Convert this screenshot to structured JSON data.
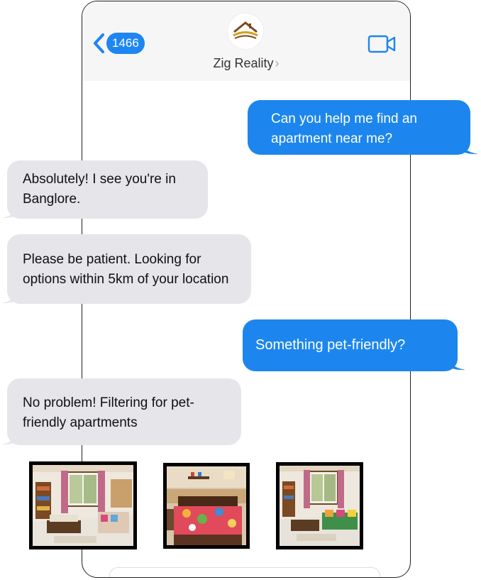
{
  "header": {
    "back_count": "1466",
    "contact_name": "Zig Reality",
    "contact_chevron": "›",
    "back_icon": "chevron-left-icon",
    "video_icon": "video-camera-icon",
    "logo": "house-logo"
  },
  "messages": [
    {
      "direction": "outgoing",
      "text": "Can you help me find an apartment near me?"
    },
    {
      "direction": "incoming",
      "text": "Absolutely! I see you're in Banglore."
    },
    {
      "direction": "incoming",
      "text": "Please be patient. Looking for options within 5km of your location"
    },
    {
      "direction": "outgoing",
      "text": "Something pet-friendly?"
    },
    {
      "direction": "incoming",
      "text": "No problem! Filtering for pet-friendly apartments"
    }
  ],
  "photos": [
    {
      "subject": "living-room-photo"
    },
    {
      "subject": "bedroom-photo"
    },
    {
      "subject": "living-room-photo"
    }
  ],
  "colors": {
    "outgoing_bubble": "#1c86ee",
    "incoming_bubble": "#e5e5ea",
    "accent": "#1d86f0"
  }
}
